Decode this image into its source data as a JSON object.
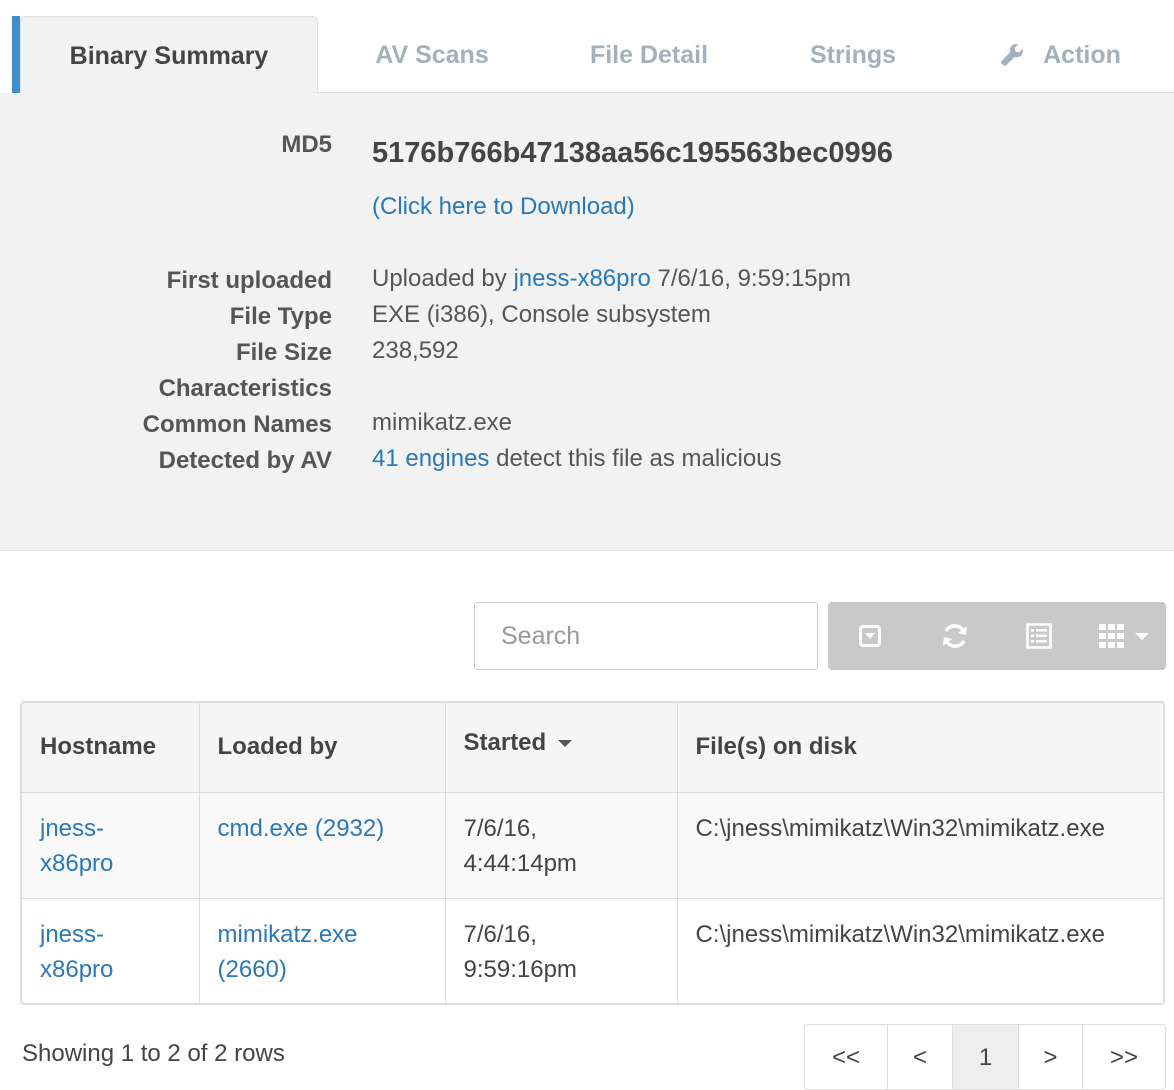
{
  "tabs": [
    {
      "label": "Binary Summary",
      "active": true
    },
    {
      "label": "AV Scans",
      "active": false
    },
    {
      "label": "File Detail",
      "active": false
    },
    {
      "label": "Strings",
      "active": false
    },
    {
      "label": "Action",
      "active": false,
      "icon": "wrench-icon"
    }
  ],
  "summary": {
    "md5_label": "MD5",
    "md5_value": "5176b766b47138aa56c195563bec0996",
    "download_link": "(Click here to Download)",
    "first_uploaded_label": "First uploaded",
    "uploaded_prefix": "Uploaded by",
    "uploaded_by": "jness-x86pro",
    "uploaded_time": "7/6/16, 9:59:15pm",
    "file_type_label": "File Type",
    "file_type": "EXE (i386), Console subsystem",
    "file_size_label": "File Size",
    "file_size": "238,592",
    "characteristics_label": "Characteristics",
    "characteristics": "",
    "common_names_label": "Common Names",
    "common_names": "mimikatz.exe",
    "detected_label": "Detected by AV",
    "detected_link": "41 engines",
    "detected_suffix": "detect this file as malicious"
  },
  "toolbar": {
    "search_placeholder": "Search",
    "buttons": [
      "toggle-icon",
      "refresh-icon",
      "list-view-icon",
      "columns-grid-icon"
    ]
  },
  "table": {
    "headers": [
      "Hostname",
      "Loaded by",
      "Started",
      "File(s) on disk"
    ],
    "sorted_column": "Started",
    "rows": [
      {
        "hostname_line1": "jness-",
        "hostname_line2": "x86pro",
        "loaded_line1": "cmd.exe (2932)",
        "loaded_line2": "",
        "started_line1": "7/6/16,",
        "started_line2": "4:44:14pm",
        "file_on_disk": "C:\\jness\\mimikatz\\Win32\\mimikatz.exe"
      },
      {
        "hostname_line1": "jness-",
        "hostname_line2": "x86pro",
        "loaded_line1": "mimikatz.exe",
        "loaded_line2": "(2660)",
        "started_line1": "7/6/16,",
        "started_line2": "9:59:16pm",
        "file_on_disk": "C:\\jness\\mimikatz\\Win32\\mimikatz.exe"
      }
    ]
  },
  "footer": {
    "showing_text": "Showing 1 to 2 of 2 rows",
    "pager": [
      "<<",
      "<",
      "1",
      ">",
      ">>"
    ],
    "current_page": "1"
  },
  "colors": {
    "accent": "#3d8fcc",
    "link": "#2a78b8",
    "panel_bg": "#f2f2f2",
    "inactive_tab": "#a5b0be",
    "toolbar_bg": "#c9c9c9"
  }
}
